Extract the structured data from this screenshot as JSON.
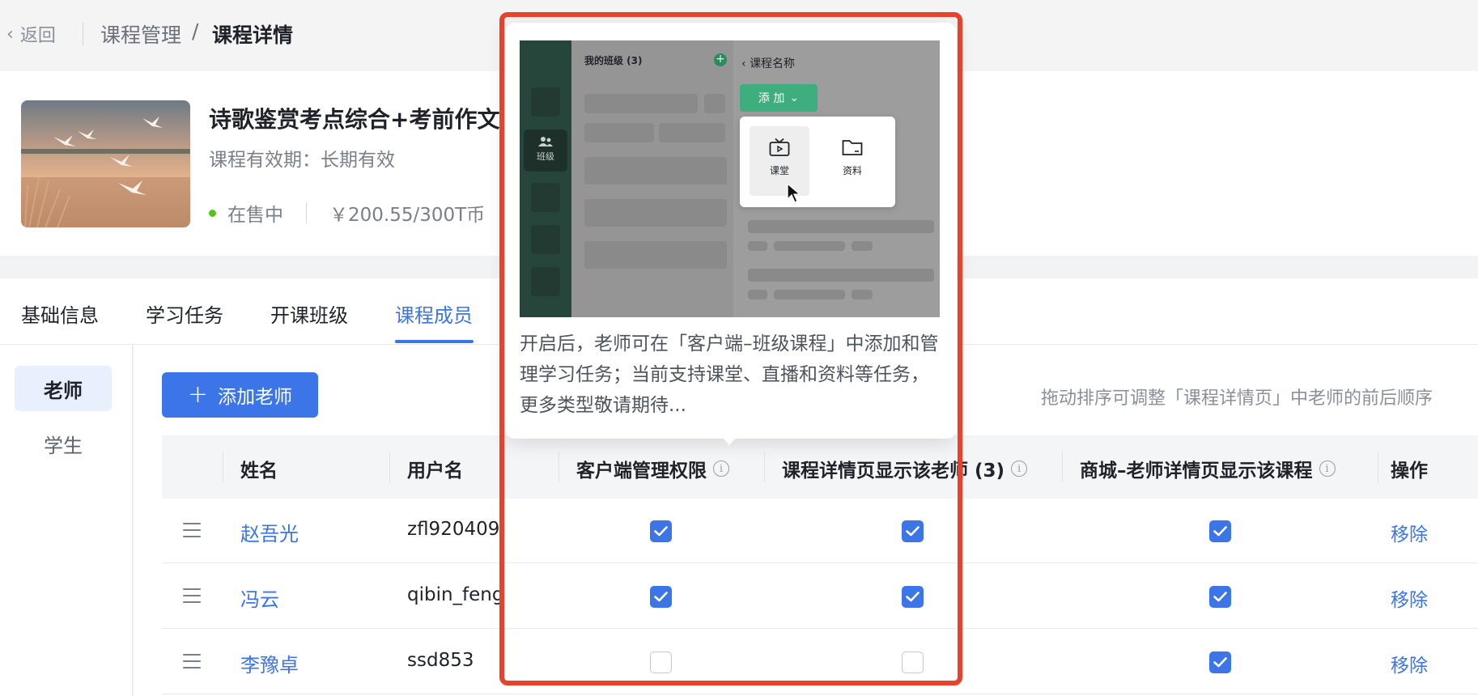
{
  "breadcrumb": {
    "back_label": "返回",
    "parent": "课程管理",
    "separator": "/",
    "current": "课程详情"
  },
  "course": {
    "title": "诗歌鉴赏考点综合+考前作文",
    "validity": "课程有效期：长期有效",
    "status": "在售中",
    "price": "￥200.55/300T币",
    "status_color": "#52c41a"
  },
  "tabs": [
    {
      "label": "基础信息"
    },
    {
      "label": "学习任务"
    },
    {
      "label": "开课班级"
    },
    {
      "label": "课程成员",
      "active": true
    }
  ],
  "sidebar": {
    "items": [
      {
        "label": "老师",
        "active": true
      },
      {
        "label": "学生"
      }
    ]
  },
  "toolbar": {
    "add_teacher_label": "添加老师",
    "hint": "拖动排序可调整「课程详情页」中老师的前后顺序"
  },
  "table": {
    "columns": [
      {
        "label": "姓名"
      },
      {
        "label": "用户名"
      },
      {
        "label": "客户端管理权限",
        "has_info": true
      },
      {
        "label": "课程详情页显示该老师 (3)",
        "has_info": true
      },
      {
        "label": "商城–老师详情页显示该课程",
        "has_info": true
      },
      {
        "label": "操作"
      }
    ],
    "rows": [
      {
        "name": "赵吾光",
        "username": "zfl920409",
        "client_admin": true,
        "show_on_detail": true,
        "show_in_mall": true,
        "action": "移除"
      },
      {
        "name": "冯云",
        "username": "qibin_feng",
        "client_admin": true,
        "show_on_detail": true,
        "show_in_mall": true,
        "action": "移除"
      },
      {
        "name": "李豫卓",
        "username": "ssd853",
        "client_admin": false,
        "show_on_detail": false,
        "show_in_mall": true,
        "action": "移除"
      }
    ]
  },
  "popover": {
    "description": "开启后，老师可在「客户端–班级课程」中添加和管理学习任务；当前支持课堂、直播和资料等任务，更多类型敬请期待...",
    "preview": {
      "rail_label": "班级",
      "list_title": "我的班级 (3)",
      "back_title": "课程名称",
      "add_label": "添 加",
      "menu_items": [
        {
          "label": "课堂",
          "icon": "tv-icon"
        },
        {
          "label": "资料",
          "icon": "folder-icon"
        }
      ]
    }
  },
  "colors": {
    "accent": "#3b75e8",
    "highlight_frame": "#e8412c",
    "preview_green": "#3fae7e"
  }
}
